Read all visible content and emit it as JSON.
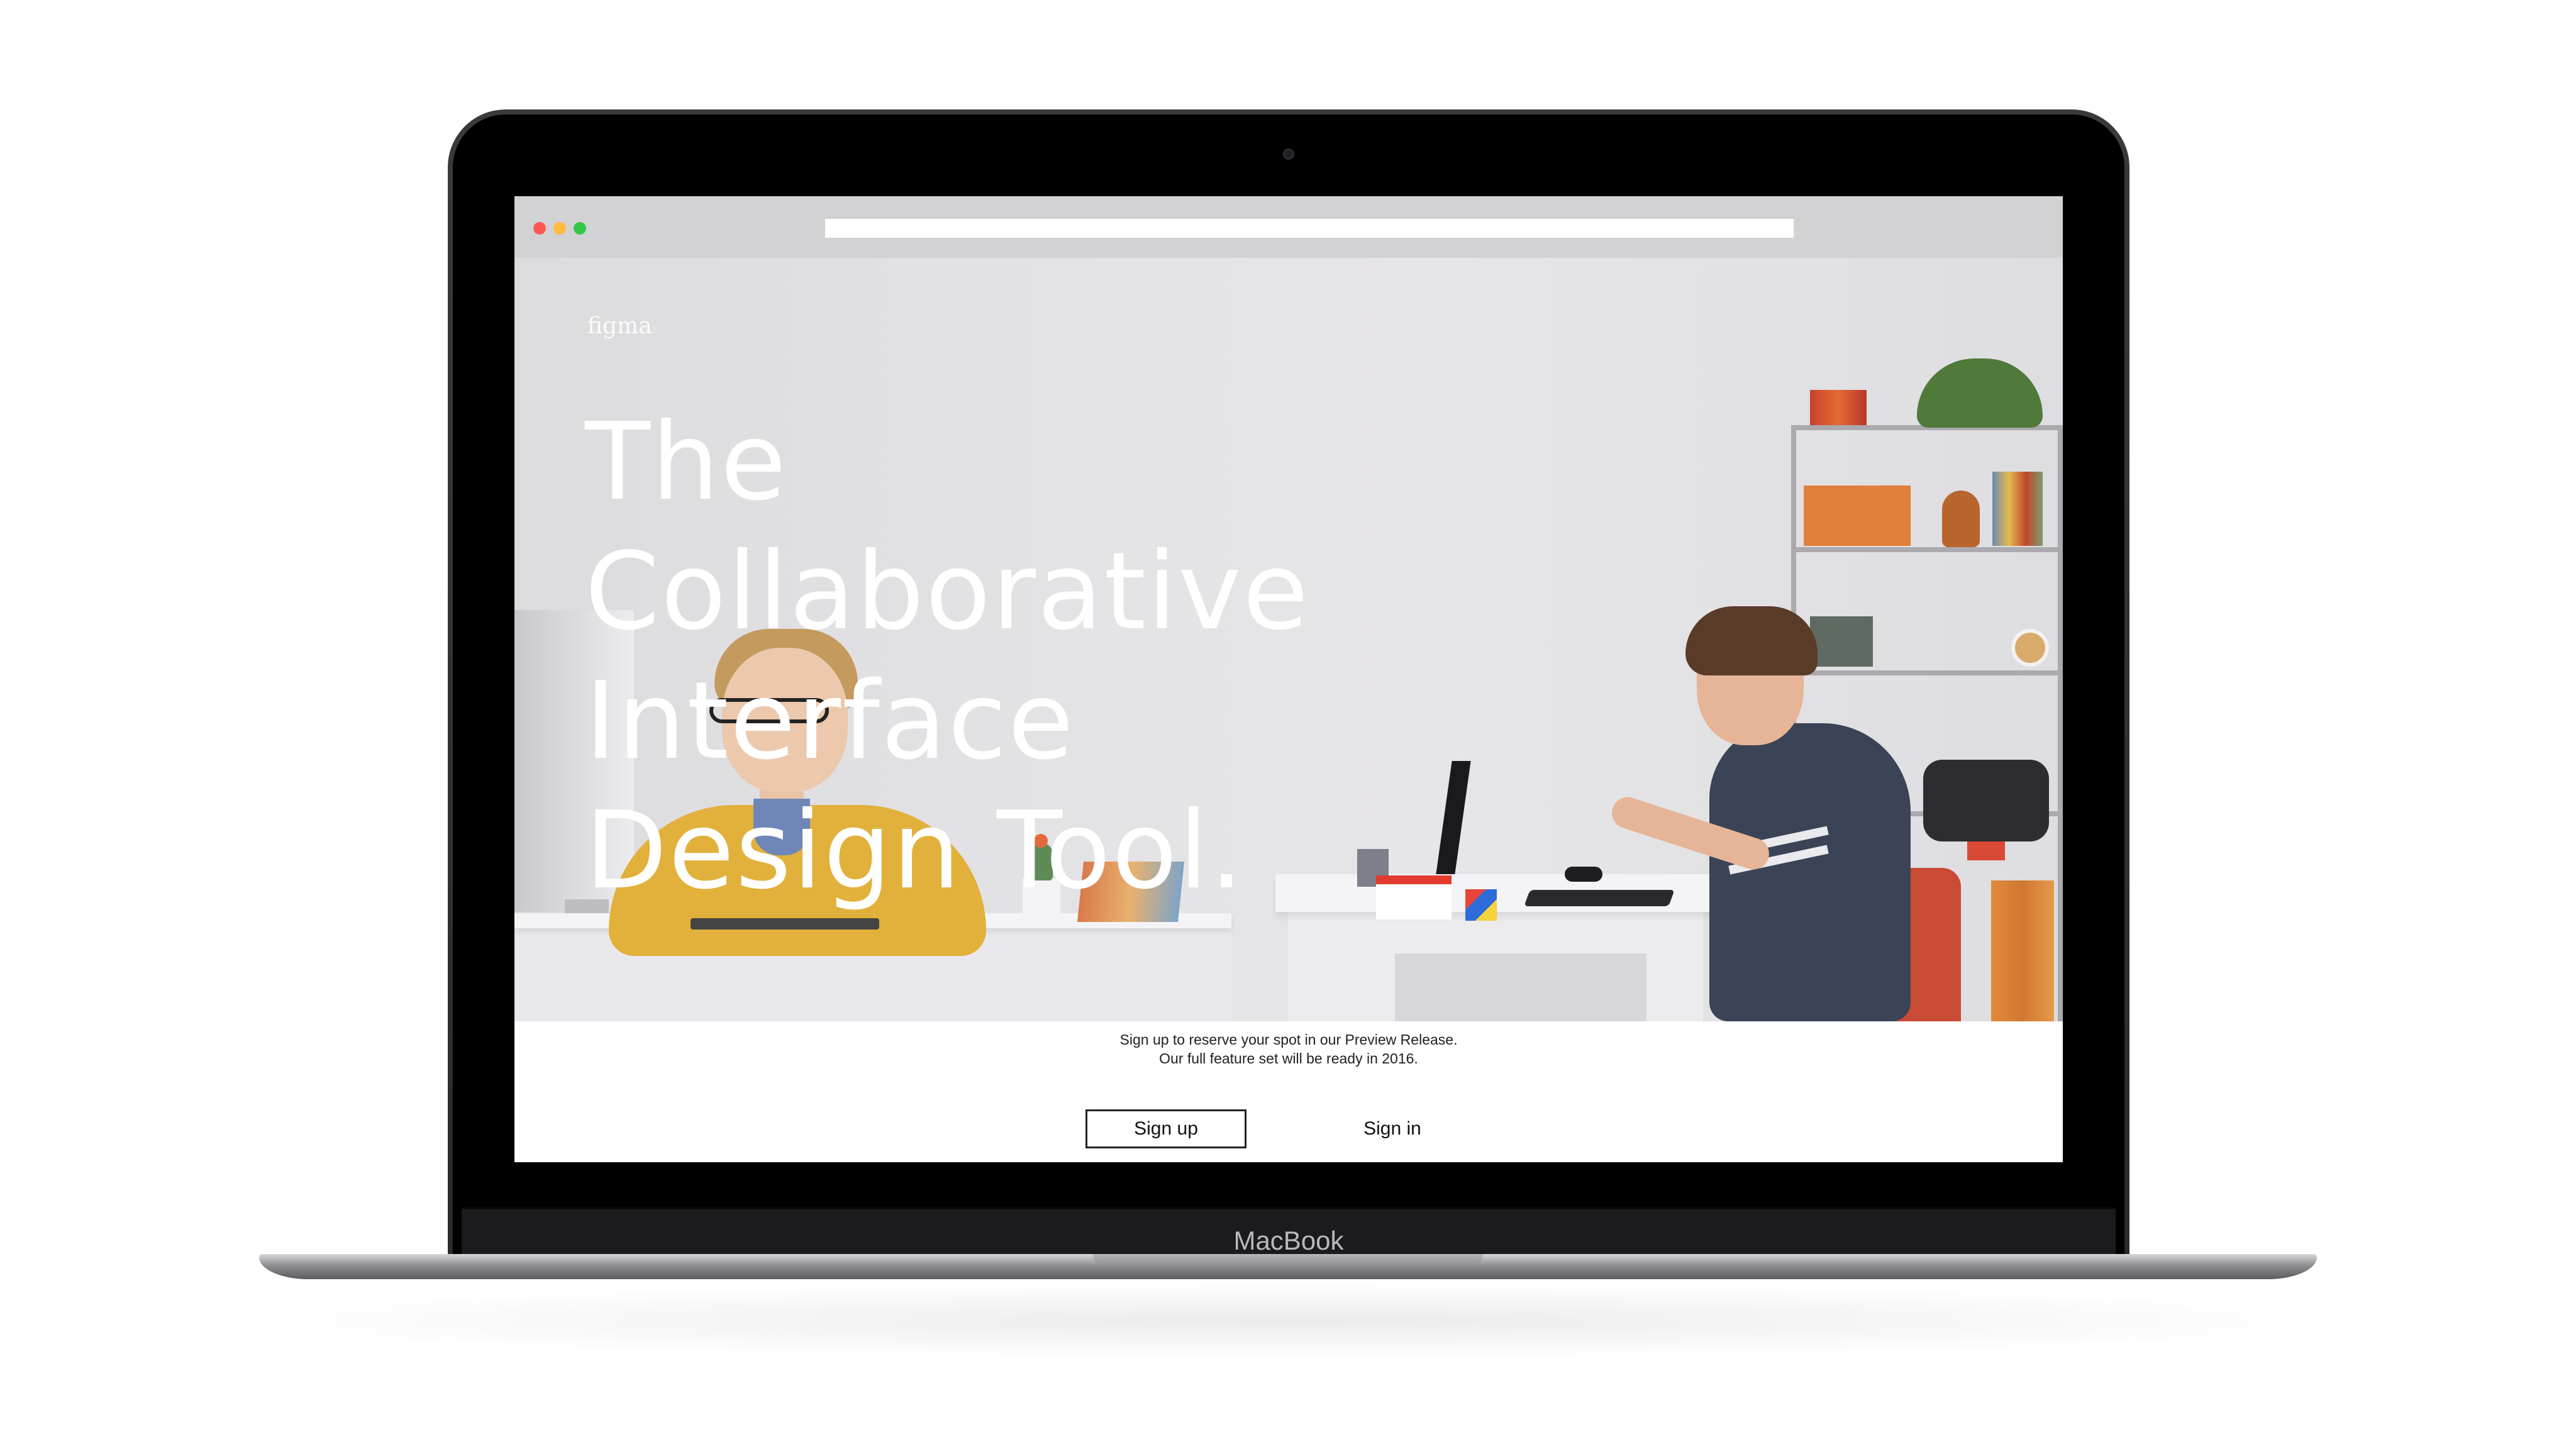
{
  "device": {
    "brand_label": "MacBook"
  },
  "browser": {
    "window_controls": [
      "close",
      "minimize",
      "maximize"
    ],
    "colors": {
      "close": "#fc5753",
      "minimize": "#fdbc40",
      "maximize": "#33c748"
    }
  },
  "page": {
    "logo": "figma",
    "headline_lines": [
      "The",
      "Collaborative",
      "Interface",
      "Design Tool."
    ],
    "cta_line1": "Sign up to reserve your spot in our Preview Release.",
    "cta_line2": "Our full feature set will be ready in 2016.",
    "signup_label": "Sign up",
    "signin_label": "Sign in"
  }
}
